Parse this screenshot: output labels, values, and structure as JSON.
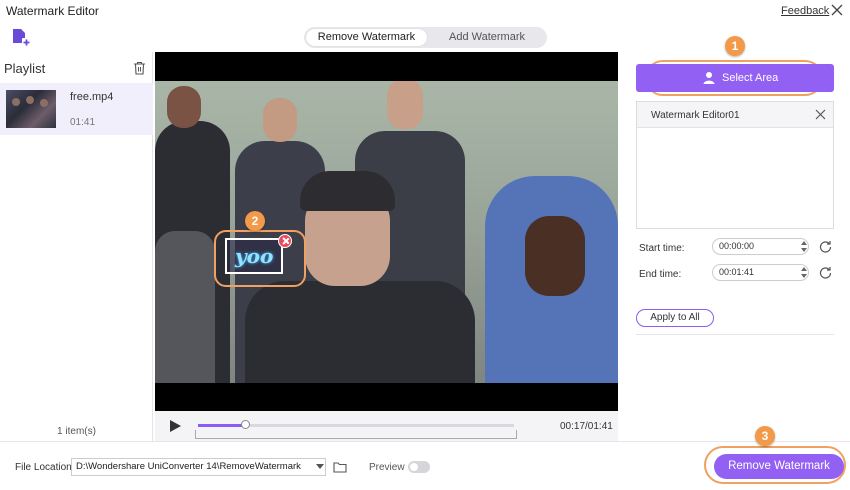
{
  "window": {
    "title": "Watermark Editor",
    "feedback_label": "Feedback",
    "close_icon": "close-icon"
  },
  "toolbar": {
    "add_file_icon": "add-file-icon",
    "tabs": [
      {
        "label": "Remove Watermark",
        "active": true
      },
      {
        "label": "Add Watermark",
        "active": false
      }
    ]
  },
  "playlist": {
    "title": "Playlist",
    "items": [
      {
        "name": "free.mp4",
        "duration": "01:41"
      }
    ],
    "count_label": "1 item(s)"
  },
  "video": {
    "watermark_text": "yoo",
    "current_time": "00:17/01:41",
    "progress": 0.15
  },
  "right_panel": {
    "select_area_label": "Select Area",
    "editor_name": "Watermark Editor01",
    "start_label": "Start time:",
    "start_value": "00:00:00",
    "end_label": "End time:",
    "end_value": "00:01:41",
    "apply_label": "Apply to All"
  },
  "bottom": {
    "file_location_label": "File Location:",
    "file_location_value": "D:\\Wondershare UniConverter 14\\RemoveWatermark",
    "preview_label": "Preview",
    "preview_on": false,
    "remove_label": "Remove Watermark"
  },
  "callouts": [
    "1",
    "2",
    "3"
  ],
  "colors": {
    "accent": "#9360f4",
    "callout": "#f2994a"
  }
}
